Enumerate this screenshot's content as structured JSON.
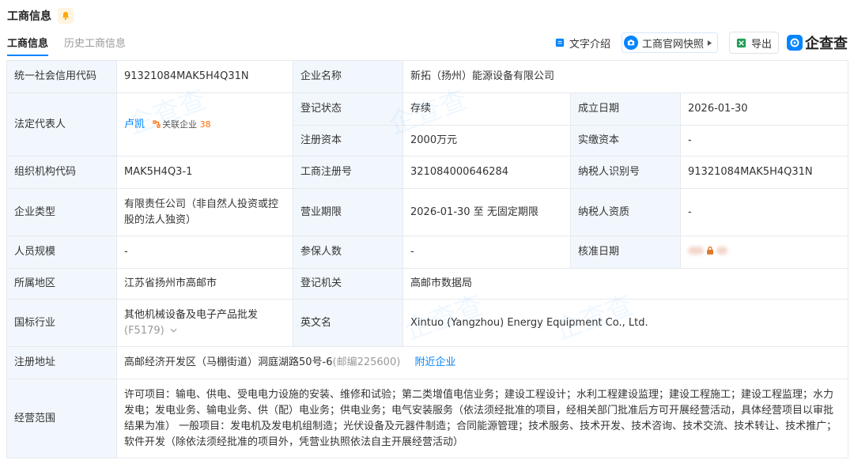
{
  "header": {
    "title": "工商信息"
  },
  "tabs": [
    {
      "label": "工商信息",
      "active": true
    },
    {
      "label": "历史工商信息",
      "active": false
    }
  ],
  "toolbar": {
    "text_intro": "文字介绍",
    "snapshot": "工商官网快照",
    "export": "导出",
    "brand": "企查查"
  },
  "colors": {
    "accent": "#0084ff",
    "label_bg": "#f2f7fd",
    "border": "#e6e9ee",
    "orange": "#ff6a00"
  },
  "rows": {
    "credit_code": {
      "label": "统一社会信用代码",
      "value": "91321084MAK5H4Q31N"
    },
    "company_name": {
      "label": "企业名称",
      "value": "新拓（扬州）能源设备有限公司"
    },
    "legal_rep": {
      "label": "法定代表人",
      "name": "卢凯",
      "related_label": "关联企业",
      "related_count": "38"
    },
    "reg_status": {
      "label": "登记状态",
      "value": "存续"
    },
    "founded": {
      "label": "成立日期",
      "value": "2026-01-30"
    },
    "reg_capital": {
      "label": "注册资本",
      "value": "2000万元"
    },
    "paid_capital": {
      "label": "实缴资本",
      "value": "-"
    },
    "org_code": {
      "label": "组织机构代码",
      "value": "MAK5H4Q3-1"
    },
    "reg_no": {
      "label": "工商注册号",
      "value": "321084000646284"
    },
    "tax_id": {
      "label": "纳税人识别号",
      "value": "91321084MAK5H4Q31N"
    },
    "company_type": {
      "label": "企业类型",
      "value": "有限责任公司（非自然人投资或控股的法人独资）"
    },
    "term": {
      "label": "营业期限",
      "value": "2026-01-30 至 无固定期限"
    },
    "taxpayer_qual": {
      "label": "纳税人资质",
      "value": "-"
    },
    "staff_size": {
      "label": "人员规模",
      "value": "-"
    },
    "insured": {
      "label": "参保人数",
      "value": "-"
    },
    "approval_date": {
      "label": "核准日期"
    },
    "region": {
      "label": "所属地区",
      "value": "江苏省扬州市高邮市"
    },
    "authority": {
      "label": "登记机关",
      "value": "高邮市数据局"
    },
    "industry": {
      "label": "国标行业",
      "value": "其他机械设备及电子产品批发",
      "code": "(F5179)"
    },
    "english_name": {
      "label": "英文名",
      "value": "Xintuo (Yangzhou) Energy Equipment Co., Ltd."
    },
    "address": {
      "label": "注册地址",
      "value": "高邮经济开发区（马棚街道）洞庭湖路50号-6",
      "postcode": "(邮编225600)",
      "nearby": "附近企业"
    },
    "scope": {
      "label": "经营范围",
      "value": "许可项目：输电、供电、受电电力设施的安装、维修和试验；第二类增值电信业务；建设工程设计；水利工程建设监理；建设工程施工；建设工程监理；水力发电；发电业务、输电业务、供（配）电业务；供电业务；电气安装服务（依法须经批准的项目，经相关部门批准后方可开展经营活动，具体经营项目以审批结果为准） 一般项目：发电机及发电机组制造；光伏设备及元器件制造；合同能源管理；技术服务、技术开发、技术咨询、技术交流、技术转让、技术推广；软件开发（除依法须经批准的项目外，凭营业执照依法自主开展经营活动）"
    }
  }
}
